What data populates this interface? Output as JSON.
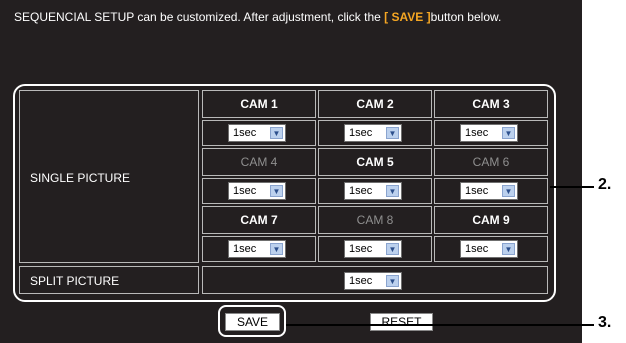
{
  "instructions": {
    "before": "SEQUENCIAL SETUP can be customized. After adjustment, click the ",
    "highlight": "[ SAVE ]",
    "after": "button below."
  },
  "single_picture": {
    "label": "SINGLE PICTURE",
    "cameras": [
      {
        "label": "CAM 1",
        "state": "active",
        "interval": "1sec"
      },
      {
        "label": "CAM 2",
        "state": "active",
        "interval": "1sec"
      },
      {
        "label": "CAM 3",
        "state": "active",
        "interval": "1sec"
      },
      {
        "label": "CAM 4",
        "state": "inactive",
        "interval": "1sec"
      },
      {
        "label": "CAM 5",
        "state": "active",
        "interval": "1sec"
      },
      {
        "label": "CAM 6",
        "state": "inactive",
        "interval": "1sec"
      },
      {
        "label": "CAM 7",
        "state": "active",
        "interval": "1sec"
      },
      {
        "label": "CAM 8",
        "state": "inactive",
        "interval": "1sec"
      },
      {
        "label": "CAM 9",
        "state": "active",
        "interval": "1sec"
      }
    ]
  },
  "split_picture": {
    "label": "SPLIT PICTURE",
    "interval": "1sec"
  },
  "buttons": {
    "save": "SAVE",
    "reset": "RESET"
  },
  "callouts": {
    "settings": "2.",
    "save": "3."
  },
  "icons": {
    "dropdown": "chevron-down-icon"
  },
  "colors": {
    "panel_bg": "#231f20",
    "highlight": "#f5a623",
    "active_text": "#ffffff",
    "inactive_text": "#8f8f8f"
  }
}
